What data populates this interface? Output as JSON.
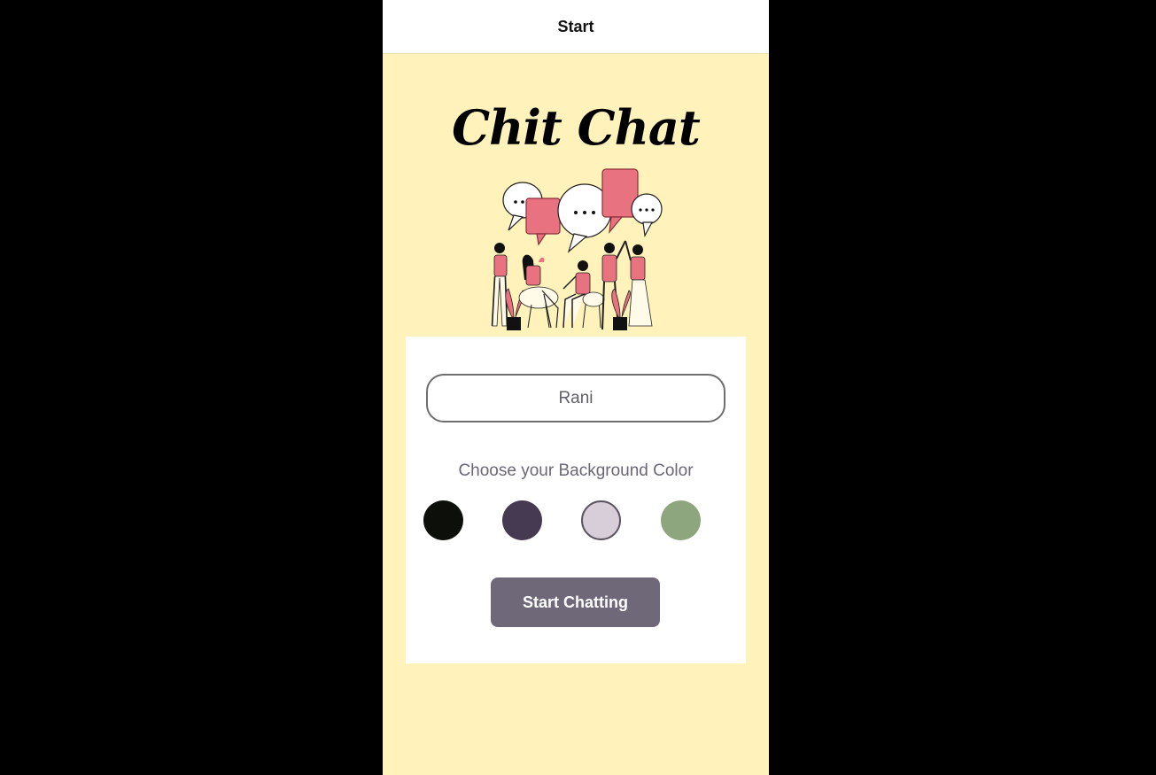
{
  "navbar": {
    "title": "Start"
  },
  "app": {
    "title": "Chit Chat"
  },
  "illustration": {
    "name": "people-chatting-illustration"
  },
  "form": {
    "name_value": "Rani",
    "color_label": "Choose your Background Color",
    "colors": [
      {
        "name": "black",
        "hex": "#0d0f0b",
        "selected": false
      },
      {
        "name": "dark-purple",
        "hex": "#463a53",
        "selected": false
      },
      {
        "name": "light-lavender",
        "hex": "#d8ceda",
        "selected": true
      },
      {
        "name": "sage-green",
        "hex": "#8ea67d",
        "selected": false
      }
    ],
    "button_label": "Start Chatting"
  },
  "theme": {
    "background": "#fff2ba",
    "accent_pink": "#e8727f",
    "button": "#6e6879"
  }
}
